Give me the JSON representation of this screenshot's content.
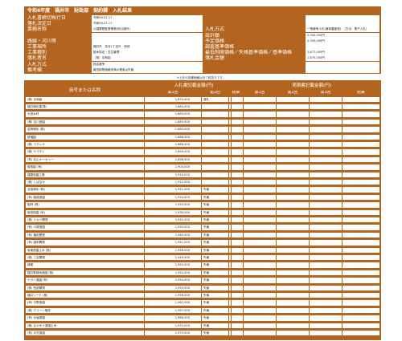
{
  "header": {
    "title": "令和6年度　福井市　財政部　契約課　入札結果",
    "rows": [
      {
        "label": "入札書締切執行日",
        "value": "令和06-07-17",
        "label2": "",
        "value2": ""
      },
      {
        "label": "落札決定日",
        "value": "令和06-07-17",
        "label2": "",
        "value2": ""
      },
      {
        "label": "業務名称",
        "value": "公園業務監督業務(西公園外)",
        "label2": "入札方式",
        "value2": "一般競争入札(事後審査型)　（方法：電子入札）"
      },
      {
        "label": "",
        "value": "",
        "label2": "設計額",
        "value2": "2,500,000円"
      },
      {
        "label": "路線・河川等",
        "value": "",
        "label2": "予定価格",
        "value2": "2,500,000円"
      },
      {
        "label": "工事場所",
        "value": "福井市　花月1丁目外　他他",
        "label2": "調査基準価格",
        "value2": ""
      },
      {
        "label": "工事種別",
        "value": "樹木剪定・芝生管理",
        "label2": "最低制限価格／失格基準価格／基準価格",
        "value2": "1,877,000円"
      },
      {
        "label": "落札者名",
        "value": "（株）京和組",
        "label2": "落札金額",
        "value2": "1,870,000円"
      },
      {
        "label": "入札方式",
        "value": "指名競争",
        "label2": "",
        "value2": ""
      },
      {
        "label": "備考欄",
        "value": "最低制限価格未満の業者は失格",
        "label2": "",
        "value2": ""
      }
    ]
  },
  "note": "※上記の各種価格は全て税抜きです。",
  "table": {
    "col_name": "商号または名称",
    "group_bid": "入札書記載金額(円)",
    "group_estimate": "見積書記載金額(円)",
    "round1": "第1回",
    "round2": "第2回",
    "round3": "第3回",
    "remarks": "結果",
    "rows": [
      {
        "name": "(株) 京和組",
        "r1": "1,870,000",
        "r2": "",
        "rm": "落札"
      },
      {
        "name": "福井緑化建(株)",
        "r1": "1,880,000",
        "r2": "",
        "rm": ""
      },
      {
        "name": "大宮木材",
        "r1": "1,883,000",
        "r2": "",
        "rm": ""
      },
      {
        "name": "(株) 吉川造園",
        "r1": "1,885,000",
        "r2": "",
        "rm": ""
      },
      {
        "name": "若狭緑化 (株)",
        "r1": "1,885,000",
        "r2": "",
        "rm": ""
      },
      {
        "name": "新福園",
        "r1": "1,888,000",
        "r2": "",
        "rm": ""
      },
      {
        "name": "(株) バディオ",
        "r1": "1,888,000",
        "r2": "",
        "rm": ""
      },
      {
        "name": "(株) ヤマモト",
        "r1": "1,890,000",
        "r2": "",
        "rm": ""
      },
      {
        "name": "(有) 北山ナーセリー",
        "r1": "1,896,000",
        "r2": "",
        "rm": ""
      },
      {
        "name": "緑造園 (有)",
        "r1": "1,904,000",
        "r2": "",
        "rm": ""
      },
      {
        "name": "福整造園工業",
        "r1": "1,910,000",
        "r2": "",
        "rm": ""
      },
      {
        "name": "(株) しばなか",
        "r1": "1,912,000",
        "r2": "",
        "rm": ""
      },
      {
        "name": "北信緑化 (株)",
        "r1": "1,921,000",
        "r2": "",
        "rm": "失格"
      },
      {
        "name": "(有) 高橋造園",
        "r1": "1,924,000",
        "r2": "",
        "rm": "失格"
      },
      {
        "name": "樹林 (株)",
        "r1": "1,925,000",
        "r2": "",
        "rm": "失格"
      },
      {
        "name": "南田造園 (有)",
        "r1": "1,930,000",
        "r2": "",
        "rm": "失格"
      },
      {
        "name": "(株) ミカド開発",
        "r1": "1,932,000",
        "r2": "",
        "rm": "失格"
      },
      {
        "name": "(有) 川原造園",
        "r1": "1,935,000",
        "r2": "",
        "rm": "失格"
      },
      {
        "name": "(有) 植松開発",
        "r1": "1,940,000",
        "r2": "",
        "rm": "失格"
      },
      {
        "name": "(有) 越前開発",
        "r1": "1,941,000",
        "r2": "",
        "rm": "失格"
      },
      {
        "name": "坂東造園土木 (株)",
        "r1": "1,946,000",
        "r2": "",
        "rm": "失格"
      },
      {
        "name": "(株) 三友開発",
        "r1": "1,949,000",
        "r2": "",
        "rm": "失格"
      },
      {
        "name": "緑樹",
        "r1": "1,950,000",
        "r2": "",
        "rm": "失格"
      },
      {
        "name": "福井県緑地造園 (株)",
        "r1": "1,952,000",
        "r2": "",
        "rm": "失格"
      },
      {
        "name": "ナガイ造園 (有)",
        "r1": "1,954,000",
        "r2": "",
        "rm": "失格"
      },
      {
        "name": "(株) 西部開発",
        "r1": "1,955,000",
        "r2": "",
        "rm": "失格"
      },
      {
        "name": "福井シード (株)",
        "r1": "1,956,000",
        "r2": "",
        "rm": "失格"
      },
      {
        "name": "(有) 中野造園",
        "r1": "1,962,000",
        "r2": "",
        "rm": "失格"
      },
      {
        "name": "(株) グリーン福井",
        "r1": "1,967,000",
        "r2": "",
        "rm": "失格"
      },
      {
        "name": "(有) 大塩造園",
        "r1": "1,968,000",
        "r2": "",
        "rm": "失格"
      },
      {
        "name": "(株) なかゆう造園土木",
        "r1": "1,972,000",
        "r2": "",
        "rm": "失格"
      },
      {
        "name": "(有) 大村造園",
        "r1": "1,973,000",
        "r2": "",
        "rm": "失格"
      }
    ]
  }
}
